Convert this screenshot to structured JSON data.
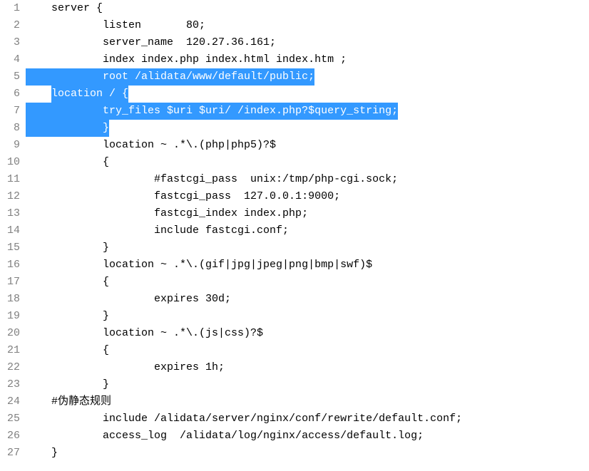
{
  "lines": [
    {
      "num": "1",
      "text": "server {",
      "indent": "    ",
      "pre_indent": ""
    },
    {
      "num": "2",
      "text": "listen       80;",
      "indent": "            ",
      "pre_indent": ""
    },
    {
      "num": "3",
      "text": "server_name  120.27.36.161;",
      "indent": "            ",
      "pre_indent": ""
    },
    {
      "num": "4",
      "text": "index index.php index.html index.htm ;",
      "indent": "            ",
      "pre_indent": ""
    },
    {
      "num": "5",
      "text": "root /alidata/www/default/public;",
      "indent": "            ",
      "pre_indent": "",
      "highlight": true
    },
    {
      "num": "6",
      "text": "location / {",
      "indent": "",
      "pre_indent": "    ",
      "highlight": true
    },
    {
      "num": "7",
      "text": "try_files $uri $uri/ /index.php?$query_string;",
      "indent": "            ",
      "pre_indent": "",
      "highlight": true
    },
    {
      "num": "8",
      "text": "}",
      "indent": "            ",
      "pre_indent": "",
      "highlight": true
    },
    {
      "num": "9",
      "text": "location ~ .*\\.(php|php5)?$",
      "indent": "            ",
      "pre_indent": ""
    },
    {
      "num": "10",
      "text": "{",
      "indent": "            ",
      "pre_indent": ""
    },
    {
      "num": "11",
      "text": "#fastcgi_pass  unix:/tmp/php-cgi.sock;",
      "indent": "                    ",
      "pre_indent": ""
    },
    {
      "num": "12",
      "text": "fastcgi_pass  127.0.0.1:9000;",
      "indent": "                    ",
      "pre_indent": ""
    },
    {
      "num": "13",
      "text": "fastcgi_index index.php;",
      "indent": "                    ",
      "pre_indent": ""
    },
    {
      "num": "14",
      "text": "include fastcgi.conf;",
      "indent": "                    ",
      "pre_indent": ""
    },
    {
      "num": "15",
      "text": "}",
      "indent": "            ",
      "pre_indent": ""
    },
    {
      "num": "16",
      "text": "location ~ .*\\.(gif|jpg|jpeg|png|bmp|swf)$",
      "indent": "            ",
      "pre_indent": ""
    },
    {
      "num": "17",
      "text": "{",
      "indent": "            ",
      "pre_indent": ""
    },
    {
      "num": "18",
      "text": "expires 30d;",
      "indent": "                    ",
      "pre_indent": ""
    },
    {
      "num": "19",
      "text": "}",
      "indent": "            ",
      "pre_indent": ""
    },
    {
      "num": "20",
      "text": "location ~ .*\\.(js|css)?$",
      "indent": "            ",
      "pre_indent": ""
    },
    {
      "num": "21",
      "text": "{",
      "indent": "            ",
      "pre_indent": ""
    },
    {
      "num": "22",
      "text": "expires 1h;",
      "indent": "                    ",
      "pre_indent": ""
    },
    {
      "num": "23",
      "text": "}",
      "indent": "            ",
      "pre_indent": ""
    },
    {
      "num": "24",
      "text": "#伪静态规则",
      "indent": "    ",
      "pre_indent": ""
    },
    {
      "num": "25",
      "text": "include /alidata/server/nginx/conf/rewrite/default.conf;",
      "indent": "            ",
      "pre_indent": ""
    },
    {
      "num": "26",
      "text": "access_log  /alidata/log/nginx/access/default.log;",
      "indent": "            ",
      "pre_indent": ""
    },
    {
      "num": "27",
      "text": "}",
      "indent": "    ",
      "pre_indent": ""
    }
  ]
}
